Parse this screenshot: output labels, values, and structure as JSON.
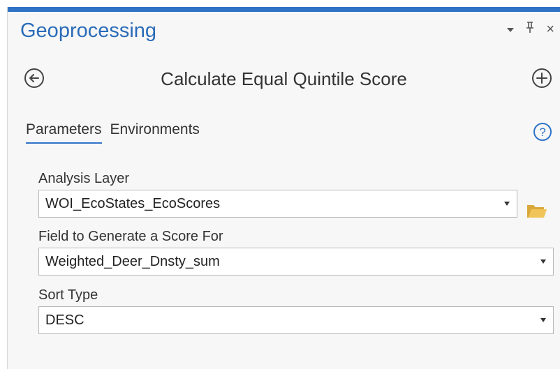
{
  "pane": {
    "title": "Geoprocessing",
    "controls": {
      "dropdown_icon": "chevron-down-icon",
      "pin_glyph": "ᵽ",
      "close_glyph": "×"
    }
  },
  "tool": {
    "title": "Calculate Equal Quintile Score",
    "back_icon": "back-arrow-circle-icon",
    "add_icon": "plus-circle-icon"
  },
  "tabs": [
    {
      "label": "Parameters",
      "active": true
    },
    {
      "label": "Environments",
      "active": false
    }
  ],
  "help_icon": "help-circle-icon",
  "parameters": {
    "analysis_layer": {
      "label": "Analysis Layer",
      "value": "WOI_EcoStates_EcoScores",
      "browse_icon": "folder-open-icon"
    },
    "field": {
      "label": "Field to Generate a Score For",
      "value": "Weighted_Deer_Dnsty_sum"
    },
    "sort_type": {
      "label": "Sort Type",
      "value": "DESC"
    }
  },
  "colors": {
    "accent": "#2f73c7",
    "title": "#2b6cb8",
    "folder": "#e8b94a"
  }
}
